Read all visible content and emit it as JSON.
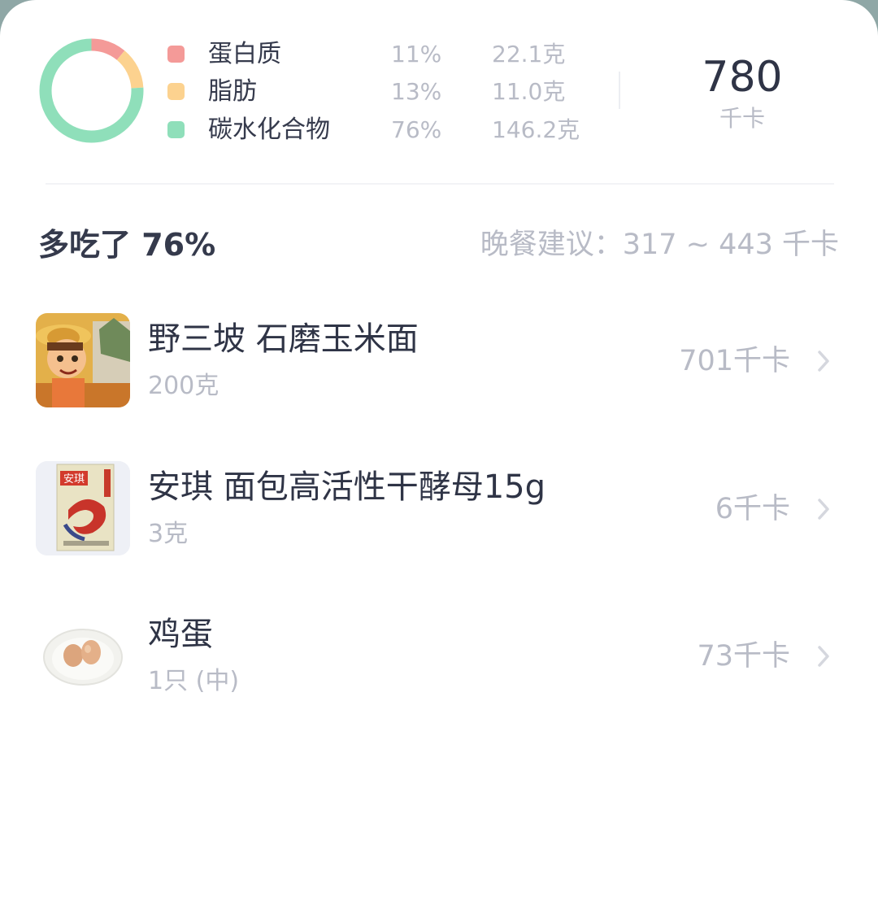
{
  "summary": {
    "macros": [
      {
        "name": "蛋白质",
        "percent": "11%",
        "grams": "22.1克",
        "color": "#f49a98",
        "fraction": 0.11
      },
      {
        "name": "脂肪",
        "percent": "13%",
        "grams": "11.0克",
        "color": "#fcd28f",
        "fraction": 0.13
      },
      {
        "name": "碳水化合物",
        "percent": "76%",
        "grams": "146.2克",
        "color": "#8fdfba",
        "fraction": 0.76
      }
    ],
    "total_kcal": "780",
    "total_unit": "千卡"
  },
  "status": {
    "over_text": "多吃了 76%",
    "suggestion_text": "晚餐建议：317 ~ 443 千卡"
  },
  "foods": [
    {
      "name": "野三坡 石磨玉米面",
      "amount": "200克",
      "kcal": "701千卡",
      "thumb": "corn-flour-package-image"
    },
    {
      "name": "安琪 面包高活性干酵母15g",
      "amount": "3克",
      "kcal": "6千卡",
      "thumb": "angel-yeast-package-image",
      "thumb_label": "安琪"
    },
    {
      "name": "鸡蛋",
      "amount": "1只 (中)",
      "kcal": "73千卡",
      "thumb": "eggs-on-plate-image"
    }
  ]
}
